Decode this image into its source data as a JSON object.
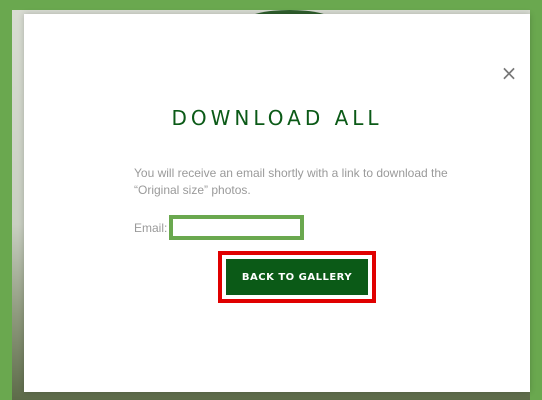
{
  "modal": {
    "close_icon": "×",
    "title": "DOWNLOAD ALL",
    "description": "You will receive an email shortly with a link to download the “Original size” photos.",
    "email_label": "Email:",
    "email_value": "",
    "back_button_label": "BACK TO GALLERY"
  },
  "colors": {
    "brand_green": "#0b5a17",
    "highlight_green": "#6aa84f",
    "highlight_red": "#e00000"
  }
}
